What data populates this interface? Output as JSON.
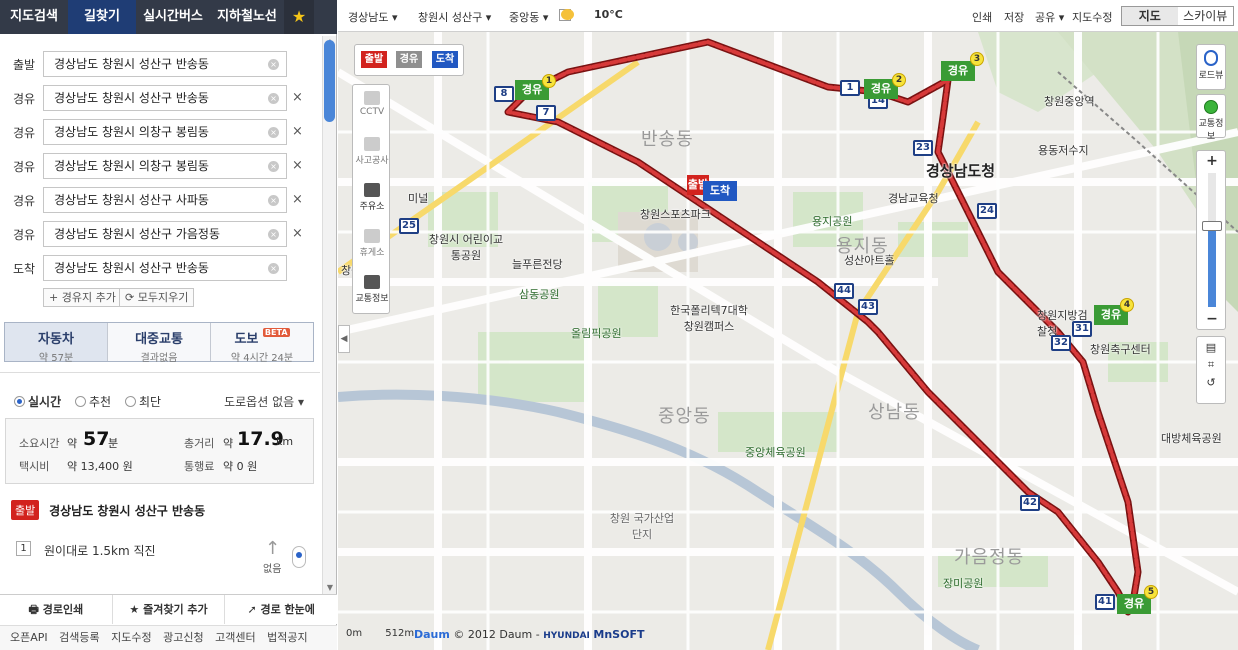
{
  "nav": {
    "tabs": [
      {
        "label": "지도검색"
      },
      {
        "label": "길찾기"
      },
      {
        "label": "실시간버스"
      },
      {
        "label": "지하철노선"
      }
    ],
    "star": "★"
  },
  "route": {
    "rows": [
      {
        "label": "출발",
        "value": "경상남도 창원시 성산구 반송동"
      },
      {
        "label": "경유",
        "value": "경상남도 창원시 성산구 반송동"
      },
      {
        "label": "경유",
        "value": "경상남도 창원시 의창구 봉림동"
      },
      {
        "label": "경유",
        "value": "경상남도 창원시 의창구 봉림동"
      },
      {
        "label": "경유",
        "value": "경상남도 창원시 성산구 사파동"
      },
      {
        "label": "경유",
        "value": "경상남도 창원시 성산구 가음정동"
      },
      {
        "label": "도착",
        "value": "경상남도 창원시 성산구 반송동"
      }
    ],
    "add_waypoint": "+ 경유지 추가",
    "clear_all": "모두지우기"
  },
  "modes": [
    {
      "title": "자동차",
      "sub": "약 57분"
    },
    {
      "title": "대중교통",
      "sub": "결과없음"
    },
    {
      "title": "도보",
      "sub": "약 4시간 24분",
      "badge": "BETA"
    }
  ],
  "options": {
    "radios": [
      "실시간",
      "추천",
      "최단"
    ],
    "road_option": "도로옵션 없음 ▾"
  },
  "summary": {
    "time_label": "소요시간",
    "time_prefix": "약",
    "time_value": "57",
    "time_unit": "분",
    "dist_label": "총거리",
    "dist_prefix": "약",
    "dist_value": "17.9",
    "dist_unit": "km",
    "taxi_label": "택시비",
    "taxi_value": "약 13,400 원",
    "toll_label": "통행료",
    "toll_value": "약 0 원"
  },
  "start": {
    "badge": "출발",
    "address": "경상남도 창원시 성산구 반송동"
  },
  "step": {
    "num": "1",
    "text": "원이대로 1.5km 직진",
    "none": "없음"
  },
  "bottom_buttons": [
    "경로인쇄",
    "즐겨찾기 추가",
    "경로 한눈에"
  ],
  "footer": [
    "오픈API",
    "검색등록",
    "지도수정",
    "광고신청",
    "고객센터",
    "법적공지"
  ],
  "maptop": {
    "region1": "경상남도 ▾",
    "region2": "창원시 성산구 ▾",
    "region3": "중앙동 ▾",
    "temp": "10°C",
    "links": [
      "인쇄",
      "저장",
      "공유 ▾",
      "지도수정"
    ],
    "view_map": "지도",
    "view_sky": "스카이뷰"
  },
  "legend": [
    "출발",
    "경유",
    "도착"
  ],
  "tools": [
    "CCTV",
    "사고공사",
    "주유소",
    "휴게소",
    "교통정보"
  ],
  "right_controls": {
    "roadview": "로드뷰",
    "traffic": "교통정보"
  },
  "map_labels": {
    "places": [
      "창원중앙역",
      "용동저수지",
      "경상남도청",
      "경남교육청",
      "용지공원",
      "성산아트홀",
      "창원시 어린이교통공원",
      "늘푸른전당",
      "삼동공원",
      "올림픽공원",
      "창원스포츠파크",
      "한국폴리텍7대학 창원캠퍼스",
      "창원지방검찰청",
      "창원축구센터",
      "대방체육공원",
      "중앙체육공원",
      "창원 국가산업단지",
      "장미공원",
      "미널",
      "창원"
    ],
    "districts": [
      "반송동",
      "용지동",
      "중앙동",
      "상남동",
      "가음정동"
    ],
    "route_markers": [
      "8",
      "7",
      "1",
      "14",
      "23",
      "24",
      "44",
      "43",
      "31",
      "32",
      "42",
      "41",
      "25"
    ],
    "waypoint_nums": [
      "1",
      "2",
      "3",
      "4",
      "5"
    ],
    "flag_waypoint": "경유",
    "flag_start": "출발",
    "flag_end": "도착"
  },
  "scale": {
    "zero": "0m",
    "dist": "512m"
  },
  "copyright": {
    "daum": "Daum",
    "text": "© 2012 Daum - ",
    "hyundai": "HYUNDAI",
    "mnsoft": "MnSOFT"
  },
  "colors": {
    "nav_bg": "#333a48",
    "nav_active": "#1f3d75",
    "route": "#b51b1b",
    "marker": "#1f3f85",
    "waypoint_flag": "#3a9b35",
    "start_flag": "#d2231e",
    "end_flag": "#2158c2"
  }
}
